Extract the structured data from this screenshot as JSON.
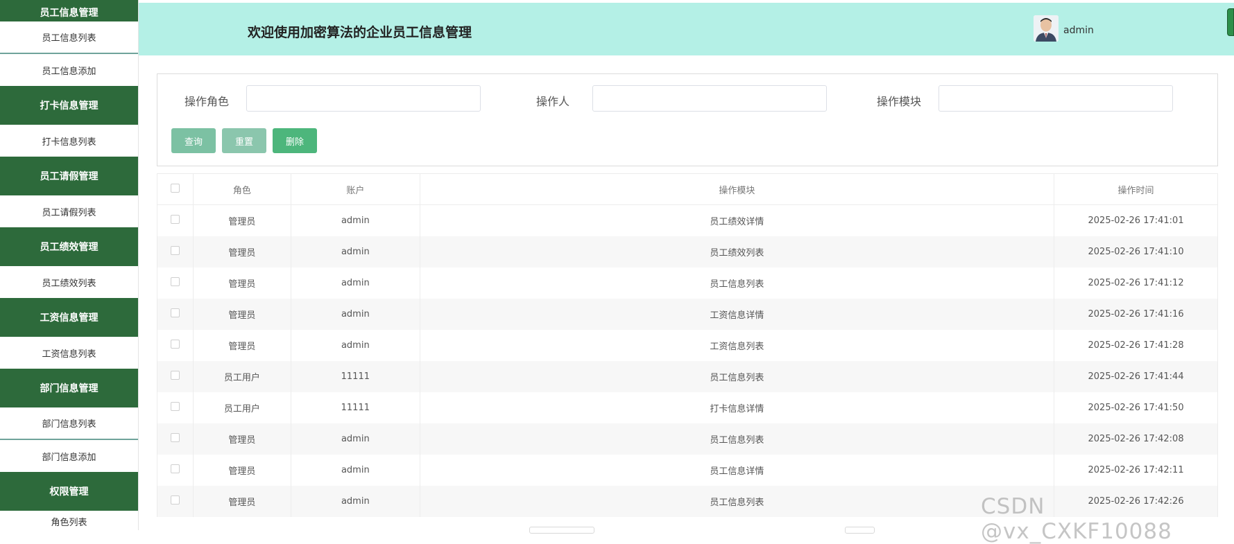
{
  "sidebar": {
    "top_group": "员工信息管理",
    "items": [
      {
        "type": "item",
        "label": "员工信息列表"
      },
      {
        "type": "item",
        "label": "员工信息添加"
      },
      {
        "type": "group",
        "label": "打卡信息管理"
      },
      {
        "type": "item",
        "label": "打卡信息列表"
      },
      {
        "type": "group",
        "label": "员工请假管理"
      },
      {
        "type": "item",
        "label": "员工请假列表"
      },
      {
        "type": "group",
        "label": "员工绩效管理"
      },
      {
        "type": "item",
        "label": "员工绩效列表"
      },
      {
        "type": "group",
        "label": "工资信息管理"
      },
      {
        "type": "item",
        "label": "工资信息列表"
      },
      {
        "type": "group",
        "label": "部门信息管理"
      },
      {
        "type": "item",
        "label": "部门信息列表"
      },
      {
        "type": "item",
        "label": "部门信息添加"
      },
      {
        "type": "group",
        "label": "权限管理"
      }
    ]
  },
  "header": {
    "title": "欢迎使用加密算法的企业员工信息管理",
    "username": "admin"
  },
  "search": {
    "role_label": "操作角色",
    "role_value": "",
    "operator_label": "操作人",
    "operator_value": "",
    "module_label": "操作模块",
    "module_value": "",
    "query_label": "查询",
    "reset_label": "重置",
    "delete_label": "删除"
  },
  "table": {
    "headers": {
      "role": "角色",
      "account": "账户",
      "module": "操作模块",
      "time": "操作时间"
    },
    "rows": [
      {
        "role": "管理员",
        "account": "admin",
        "module": "员工绩效详情",
        "time": "2025-02-26 17:41:01"
      },
      {
        "role": "管理员",
        "account": "admin",
        "module": "员工绩效列表",
        "time": "2025-02-26 17:41:10"
      },
      {
        "role": "管理员",
        "account": "admin",
        "module": "员工信息列表",
        "time": "2025-02-26 17:41:12"
      },
      {
        "role": "管理员",
        "account": "admin",
        "module": "工资信息详情",
        "time": "2025-02-26 17:41:16"
      },
      {
        "role": "管理员",
        "account": "admin",
        "module": "工资信息列表",
        "time": "2025-02-26 17:41:28"
      },
      {
        "role": "员工用户",
        "account": "11111",
        "module": "员工信息列表",
        "time": "2025-02-26 17:41:44"
      },
      {
        "role": "员工用户",
        "account": "11111",
        "module": "打卡信息详情",
        "time": "2025-02-26 17:41:50"
      },
      {
        "role": "管理员",
        "account": "admin",
        "module": "员工信息列表",
        "time": "2025-02-26 17:42:08"
      },
      {
        "role": "管理员",
        "account": "admin",
        "module": "员工信息详情",
        "time": "2025-02-26 17:42:11"
      },
      {
        "role": "管理员",
        "account": "admin",
        "module": "员工信息列表",
        "time": "2025-02-26 17:42:26"
      }
    ]
  },
  "watermark": "CSDN @vx_CXKF10088",
  "colors": {
    "sidebar_group": "#2d6a3b",
    "header_bg": "#b4f0e6",
    "btn_delete": "#4db67c"
  }
}
